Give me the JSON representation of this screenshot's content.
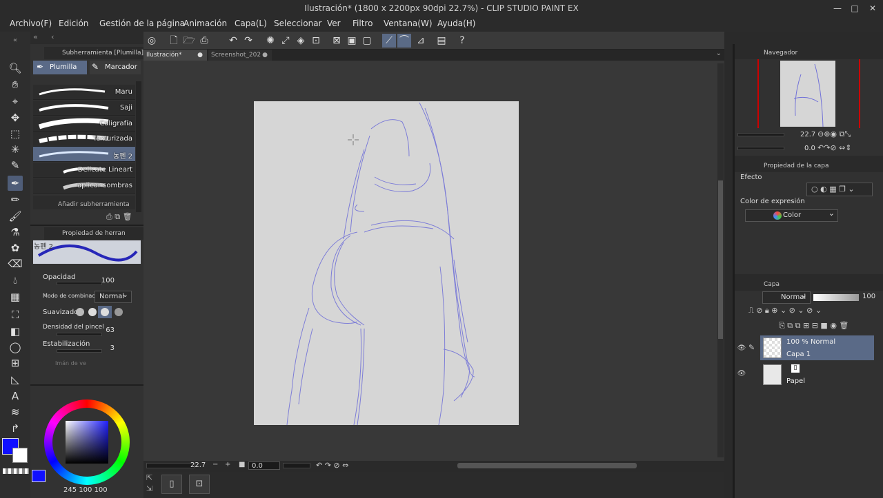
{
  "window": {
    "title": "Ilustración* (1800 x 2200px 90dpi 22.7%)  - CLIP STUDIO PAINT EX"
  },
  "menu": [
    "Archivo(F)",
    "Edición",
    "Gestión de la página",
    "Animación",
    "Capa(L)",
    "Seleccionar",
    "Ver",
    "Filtro",
    "Ventana(W)",
    "Ayuda(H)"
  ],
  "subtool_panel": {
    "title": "Subherramienta [Plumilla]",
    "tabs": [
      "Plumilla",
      "Marcador"
    ],
    "brushes": [
      "Maru",
      "Saji",
      "Caligrafía",
      "Texturizada",
      "농펜 2",
      "Delicate Lineart",
      "aplicar sombras"
    ],
    "add": "Añadir subherramienta"
  },
  "tool_property": {
    "title": "Propiedad de herran",
    "brush_name": "농펜 2",
    "opacity_label": "Opacidad",
    "opacity_value": "100",
    "blend_label": "Modo de combinació",
    "blend_value": "Normal",
    "smoothing_label": "Suavizado",
    "density_label": "Densidad del pincel",
    "density_value": "63",
    "stabilization_label": "Estabilización",
    "stabilization_value": "3",
    "magnet_label": "Imán de ve"
  },
  "color": {
    "main": "#1010ff",
    "sub": "#ffffff",
    "values": [
      "245",
      "100",
      "100"
    ]
  },
  "doc_tabs": [
    "Ilustración*",
    "Screenshot_202"
  ],
  "status": {
    "zoom": "22.7",
    "angle": "0.0"
  },
  "navigator": {
    "title": "Navegador",
    "zoom": "22.7",
    "angle": "0.0"
  },
  "layer_property": {
    "title": "Propiedad de la capa",
    "effect_label": "Efecto",
    "color_label": "Color de expresión",
    "color_value": "Color"
  },
  "layers_panel": {
    "title": "Capa",
    "blend": "Normal",
    "opacity": "100",
    "layers": [
      {
        "mode": "100 % Normal",
        "name": "Capa 1"
      },
      {
        "name": "Papel"
      }
    ]
  }
}
